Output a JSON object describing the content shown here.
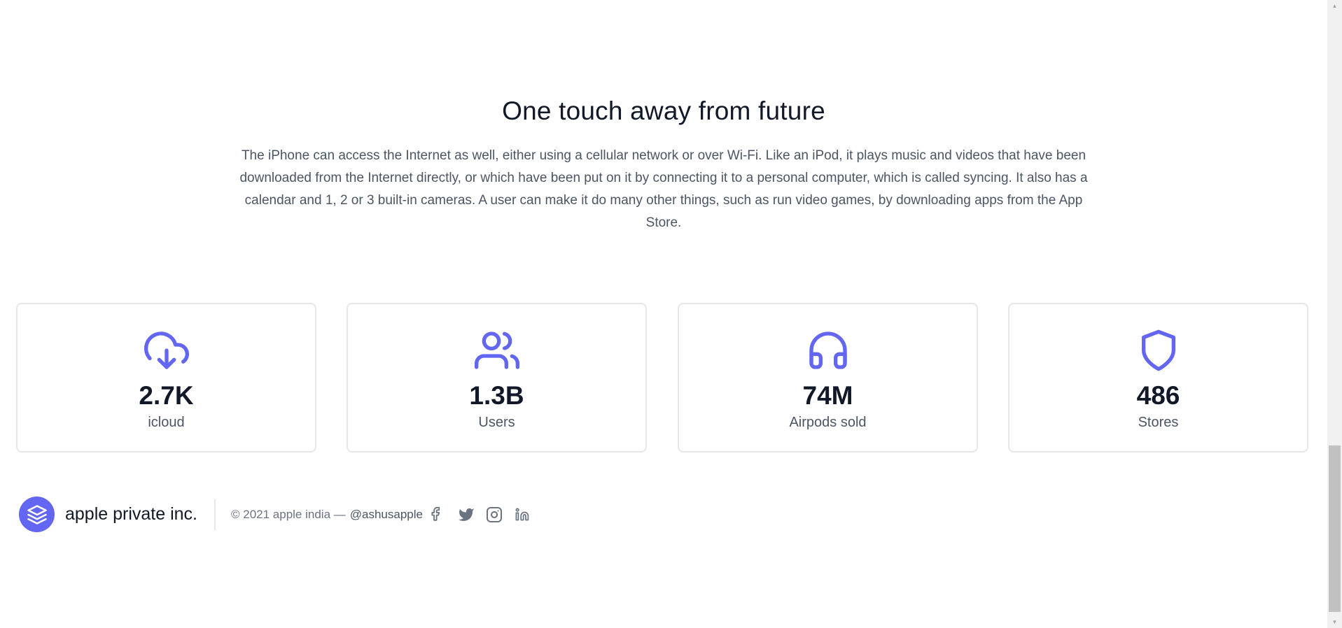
{
  "hero": {
    "title": "One touch away from future",
    "description": "The iPhone can access the Internet as well, either using a cellular network or over Wi-Fi. Like an iPod, it plays music and videos that have been downloaded from the Internet directly, or which have been put on it by connecting it to a personal computer, which is called syncing. It also has a calendar and 1, 2 or 3 built-in cameras. A user can make it do many other things, such as run video games, by downloading apps from the App Store."
  },
  "stats": [
    {
      "icon": "cloud-download-icon",
      "value": "2.7K",
      "label": "icloud"
    },
    {
      "icon": "users-icon",
      "value": "1.3B",
      "label": "Users"
    },
    {
      "icon": "headphones-icon",
      "value": "74M",
      "label": "Airpods sold"
    },
    {
      "icon": "shield-icon",
      "value": "486",
      "label": "Stores"
    }
  ],
  "footer": {
    "brand": "apple private inc.",
    "copyright": "© 2021 apple india —",
    "handle": "@ashusapple",
    "socials": [
      "facebook-icon",
      "twitter-icon",
      "instagram-icon",
      "linkedin-icon"
    ]
  },
  "colors": {
    "accent": "#6366f1",
    "heading": "#111827",
    "body_text": "#4b5563",
    "card_border": "#e5e7eb"
  }
}
